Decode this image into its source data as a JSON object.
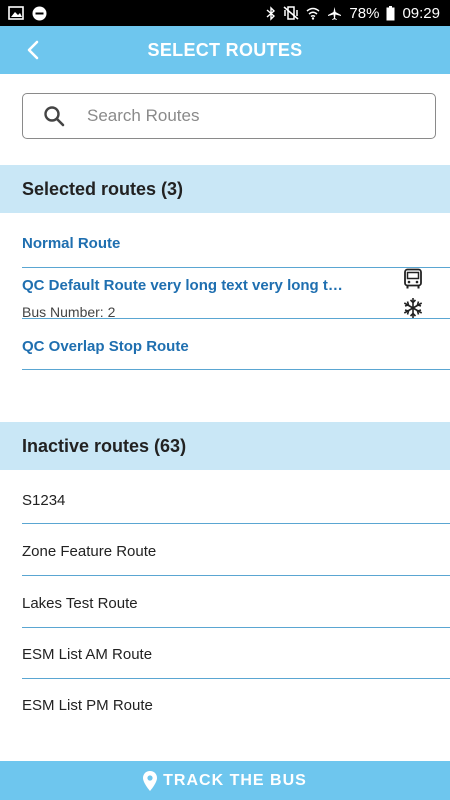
{
  "status_bar": {
    "battery": "78%",
    "time": "09:29",
    "icons": [
      "image-icon",
      "minus-circle-icon",
      "bluetooth-icon",
      "vibrate-icon",
      "wifi-icon",
      "airplane-icon",
      "battery-icon"
    ]
  },
  "app_bar": {
    "title": "SELECT ROUTES",
    "back_icon": "chevron-left-icon"
  },
  "search": {
    "placeholder": "Search Routes",
    "value": "",
    "icon": "search-icon"
  },
  "selected": {
    "header": "Selected routes (3)",
    "items": [
      {
        "label": "Normal Route"
      },
      {
        "label": "QC Default Route very long text very long t…",
        "sub": "Bus Number: 2",
        "icons": [
          "bus-icon",
          "snowflake-icon"
        ]
      },
      {
        "label": "QC Overlap Stop Route"
      }
    ]
  },
  "inactive": {
    "header": "Inactive routes (63)",
    "items": [
      {
        "label": "S1234"
      },
      {
        "label": "Zone Feature Route"
      },
      {
        "label": "Lakes Test Route"
      },
      {
        "label": "ESM List AM Route"
      },
      {
        "label": "ESM List PM Route"
      }
    ]
  },
  "footer": {
    "label": "TRACK THE BUS",
    "icon": "location-pin-icon"
  },
  "colors": {
    "accent": "#6ec6ee",
    "section_bg": "#c9e7f6",
    "link": "#1f6fb0",
    "divider": "#5aa6d2"
  }
}
